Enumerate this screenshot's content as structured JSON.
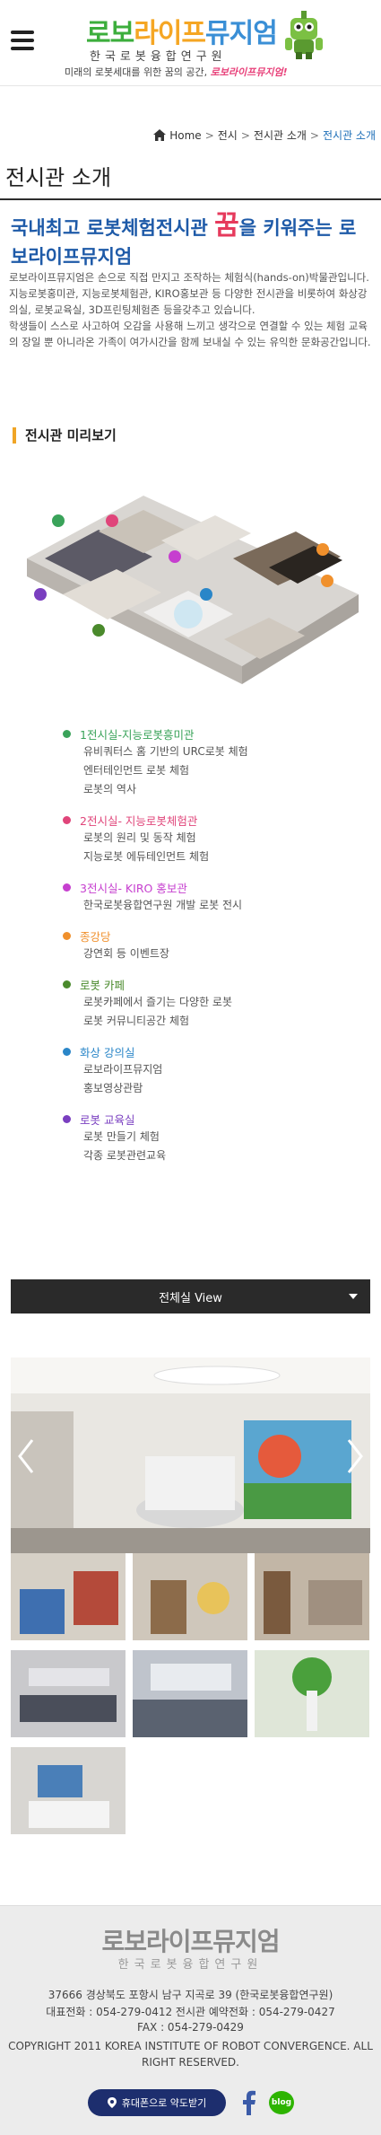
{
  "header": {
    "logo_part1": "로보",
    "logo_part2": "라이프",
    "logo_part3": "뮤지엄",
    "logo_sub": "한국로봇융합연구원",
    "tagline_prefix": "미래의 로봇세대를 위한 꿈의 공간,",
    "tagline_highlight": "로보라이프뮤지엄!",
    "menu_icon": "hamburger-menu-icon"
  },
  "breadcrumb": {
    "home": "Home",
    "items": [
      "전시",
      "전시관 소개",
      "전시관 소개"
    ],
    "separator": ">"
  },
  "page": {
    "title": "전시관 소개",
    "headline_before": "국내최고 로봇체험전시관",
    "headline_dream": "꿈",
    "headline_after": "을 키워주는 로보라이프뮤지엄",
    "intro_1": "로보라이프뮤지엄은 손으로 직접 만지고 조작하는 체험식(hands-on)박물관입니다. 지능로봇홍미관, 지능로봇체험관, KIRO홍보관 등 다양한 전시관을 비롯하여 화상강의실, 로봇교육실, 3D프린팅체험존 등을갖추고 있습니다.",
    "intro_2": "학생들이 스스로 사고하여 오감을 사용해 느끼고 생각으로 연결할 수 있는 체험 교육의 장일 뿐 아니라온 가족이 여가시간을 함께 보내실 수 있는 유익한 문화공간입니다.",
    "preview_label": "전시관 미리보기"
  },
  "rooms": [
    {
      "title": "1전시실-지능로봇흥미관",
      "color": "#3aa35a",
      "lines": [
        "유비쿼터스 홈 기반의 URC로봇 체험",
        "엔터테인먼트 로봇 체험",
        "로봇의 역사"
      ]
    },
    {
      "title": "2전시실- 지능로봇체험관",
      "color": "#e0457a",
      "lines": [
        "로봇의 원리 및 동작 체험",
        "지능로봇 에듀테인먼트 체험"
      ]
    },
    {
      "title": "3전시실- KIRO 홍보관",
      "color": "#c63fcf",
      "lines": [
        "한국로봇융합연구원 개발 로봇 전시"
      ]
    },
    {
      "title": "종강당",
      "color": "#f0902c",
      "lines": [
        "강연회 등 이벤트장"
      ]
    },
    {
      "title": "로봇 카페",
      "color": "#4a8a2c",
      "lines": [
        "로봇카페에서 즐기는 다양한 로봇",
        "로봇 커뮤니티공간 체험"
      ]
    },
    {
      "title": "화상 강의실",
      "color": "#2a86c8",
      "lines": [
        "로보라이프뮤지엄",
        "홍보영상관람"
      ]
    },
    {
      "title": "로봇 교육실",
      "color": "#7a3fc0",
      "lines": [
        "로봇 만들기 체험",
        "각종 로봇관련교육"
      ]
    }
  ],
  "dropdown": {
    "label": "전체실 View"
  },
  "footer": {
    "logo": "로보라이프뮤지엄",
    "sub": "한국로봇융합연구원",
    "address": "37666 경상북도 포항시 남구 지곡로 39 (한국로봇융합연구원)",
    "phone": "대표전화 : 054-279-0412    전시관 예약전화 : 054-279-0427",
    "fax": "FAX : 054-279-0429",
    "copyright": "COPYRIGHT 2011 KOREA INSTITUTE OF ROBOT CONVERGENCE. ALL RIGHT RESERVED.",
    "directions_button": "휴대폰으로 약도받기",
    "blog": "blog"
  },
  "colors": {
    "accent": "#1e5aa8",
    "dream": "#e63a5c",
    "dark_button": "#2a2a2a",
    "footer_button": "#1d2e6e"
  }
}
